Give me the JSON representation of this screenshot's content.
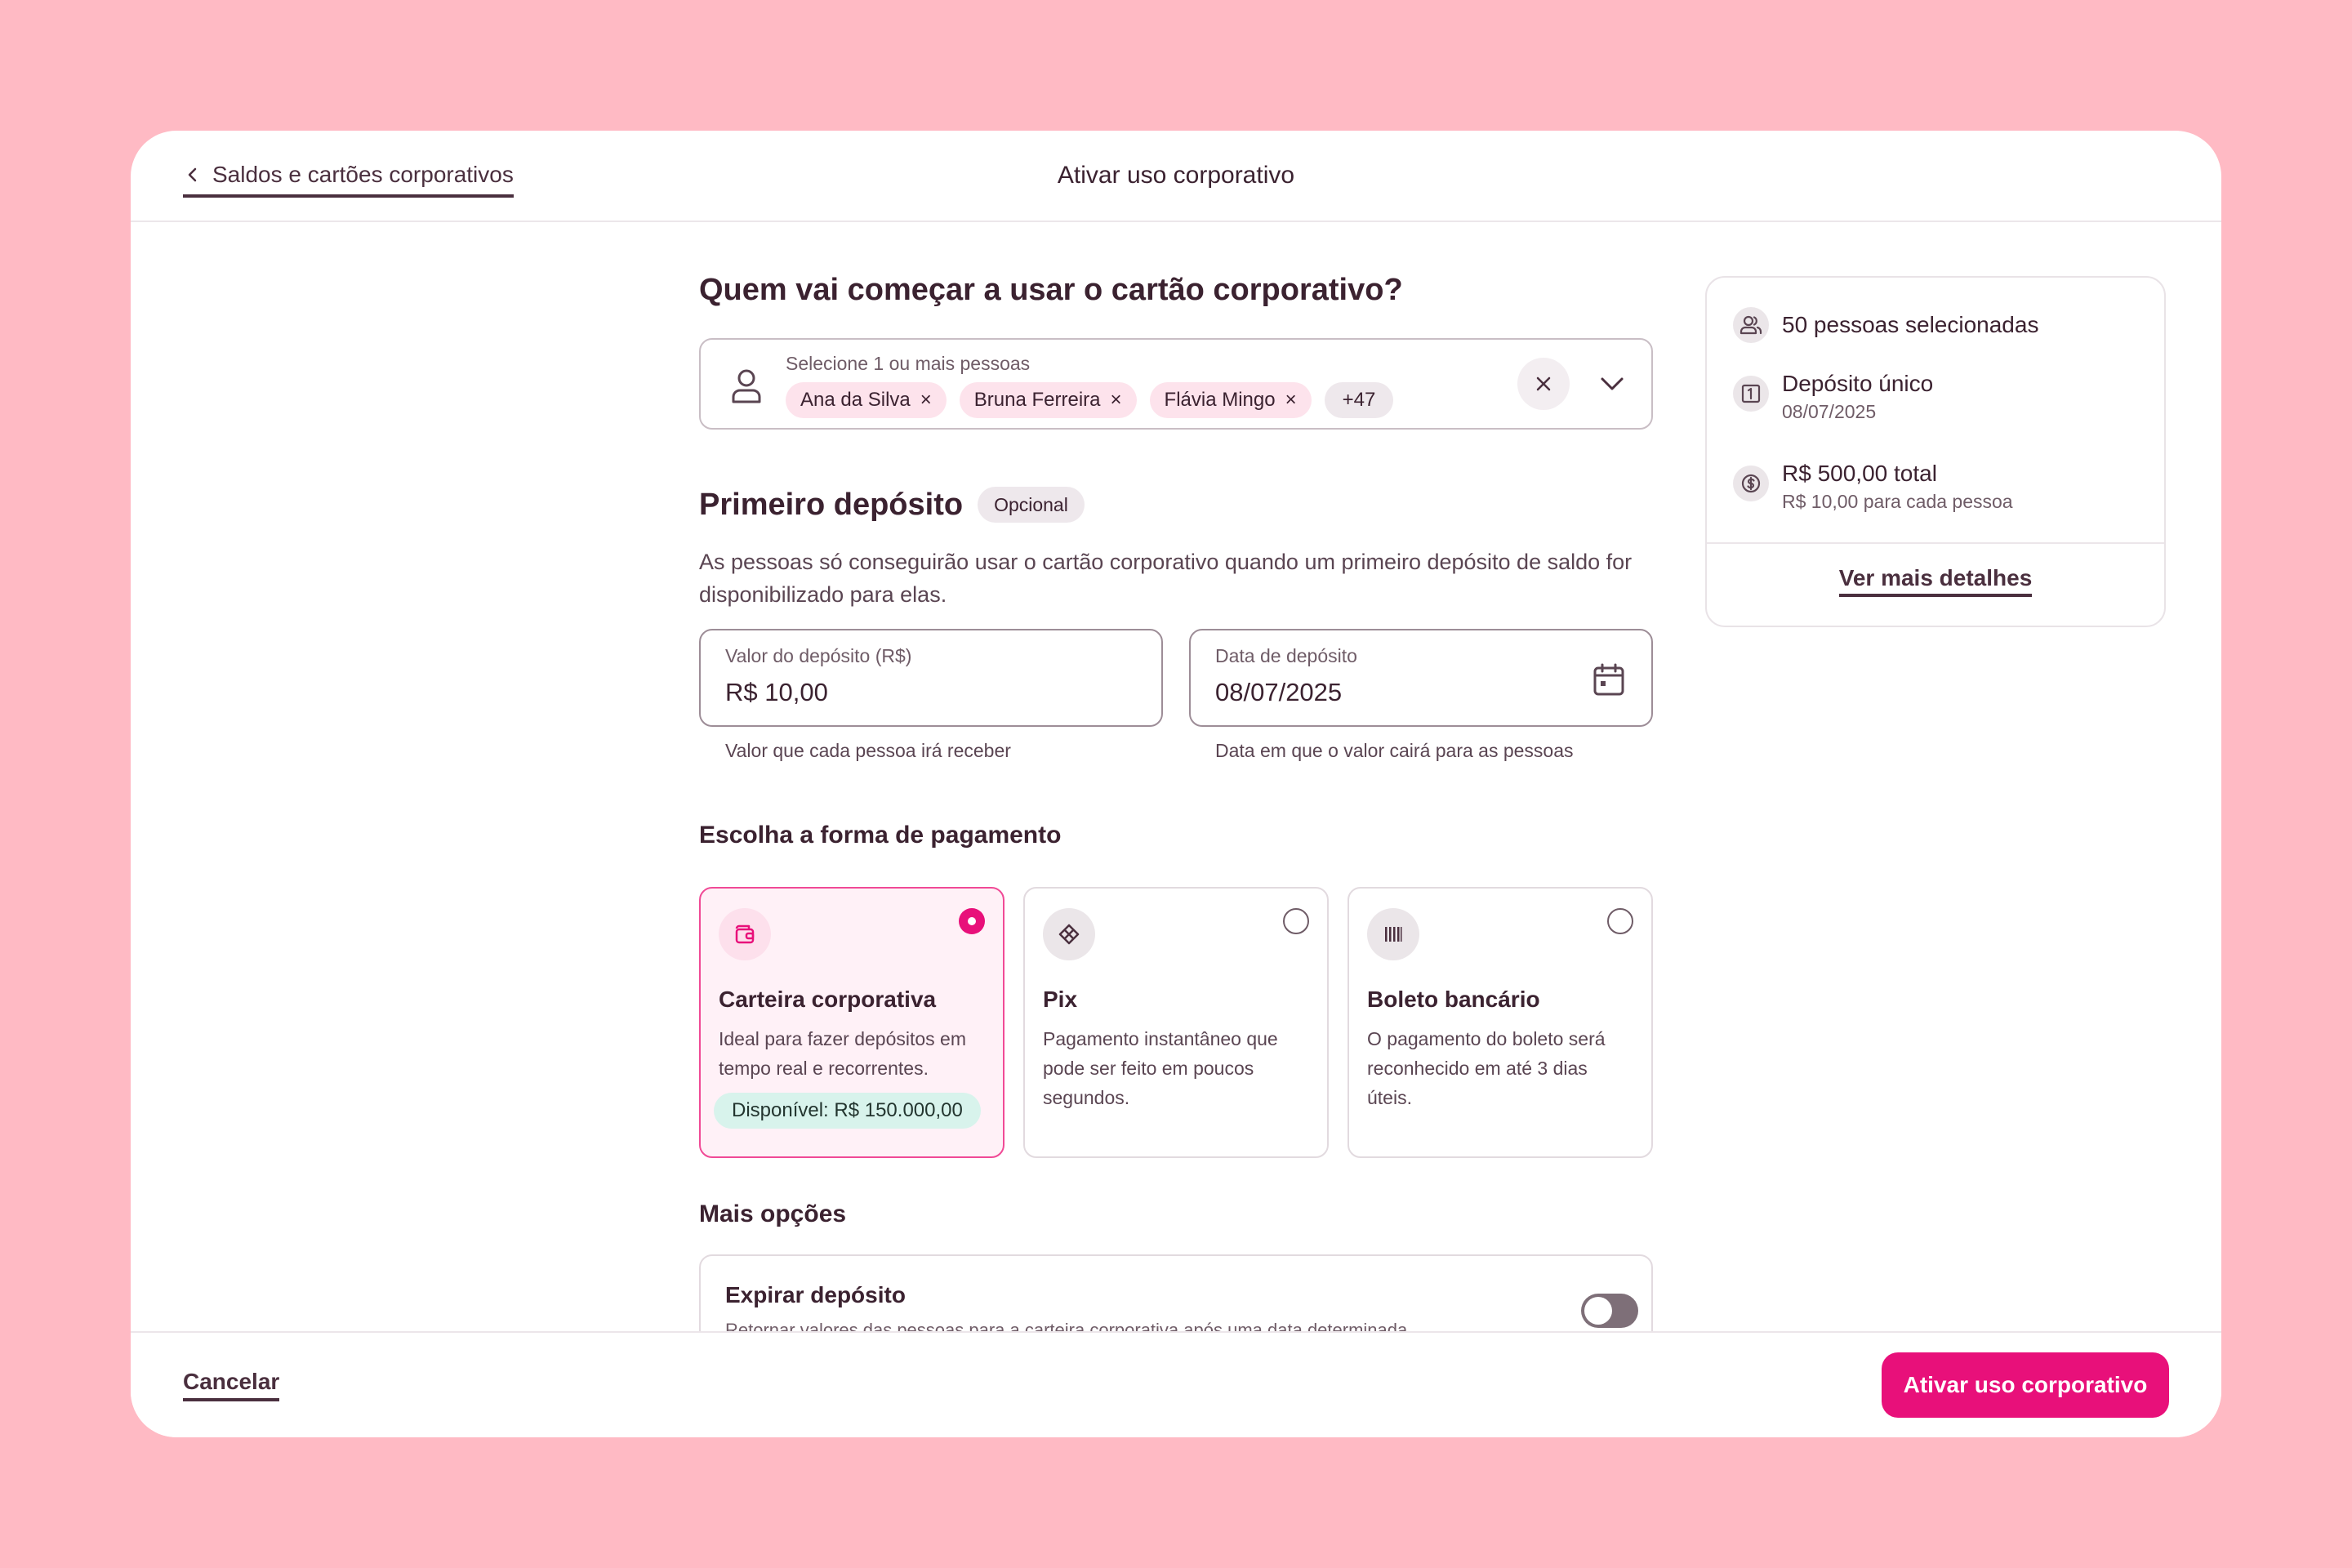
{
  "colors": {
    "background": "#ffbac4",
    "accent": "#e8107a",
    "available_badge": "#d8f3ec"
  },
  "header": {
    "back_label": "Saldos e cartões corporativos",
    "title": "Ativar uso corporativo"
  },
  "people": {
    "question": "Quem vai começar a usar o cartão corporativo?",
    "select_label": "Selecione 1 ou mais pessoas",
    "chips": [
      "Ana da Silva",
      "Bruna Ferreira",
      "Flávia Mingo"
    ],
    "more_count": "+47",
    "remove_glyph": "×"
  },
  "deposit": {
    "title": "Primeiro depósito",
    "badge": "Opcional",
    "description": "As pessoas só conseguirão usar o cartão corporativo quando um primeiro depósito de saldo for disponibilizado para elas.",
    "amount": {
      "label": "Valor do depósito (R$)",
      "value": "R$ 10,00",
      "helper": "Valor que cada pessoa irá receber"
    },
    "date": {
      "label": "Data de depósito",
      "value": "08/07/2025",
      "helper": "Data em que o valor cairá para as pessoas",
      "icon": "calendar-icon"
    }
  },
  "payment": {
    "title": "Escolha a forma de pagamento",
    "selected": "carteira",
    "options": [
      {
        "title": "Carteira corporativa",
        "description": "Ideal para fazer depósitos em tempo real e recorrentes.",
        "available": "Disponível: R$ 150.000,00",
        "icon": "wallet-icon"
      },
      {
        "title": "Pix",
        "description": "Pagamento instantâneo que pode ser feito em poucos segundos.",
        "icon": "pix-icon"
      },
      {
        "title": "Boleto bancário",
        "description": "O pagamento do boleto será reconhecido em até 3 dias úteis.",
        "icon": "barcode-icon"
      }
    ]
  },
  "more_options": {
    "title": "Mais opções",
    "expire": {
      "title": "Expirar depósito",
      "description": "Retornar valores das pessoas para a carteira corporativa após uma data determinada",
      "enabled": false
    }
  },
  "summary": {
    "people": "50 pessoas selecionadas",
    "deposit_type": "Depósito único",
    "deposit_date": "08/07/2025",
    "total": "R$ 500,00 total",
    "per_person": "R$ 10,00 para cada pessoa",
    "details_link": "Ver mais detalhes"
  },
  "footer": {
    "cancel": "Cancelar",
    "submit": "Ativar uso corporativo"
  }
}
